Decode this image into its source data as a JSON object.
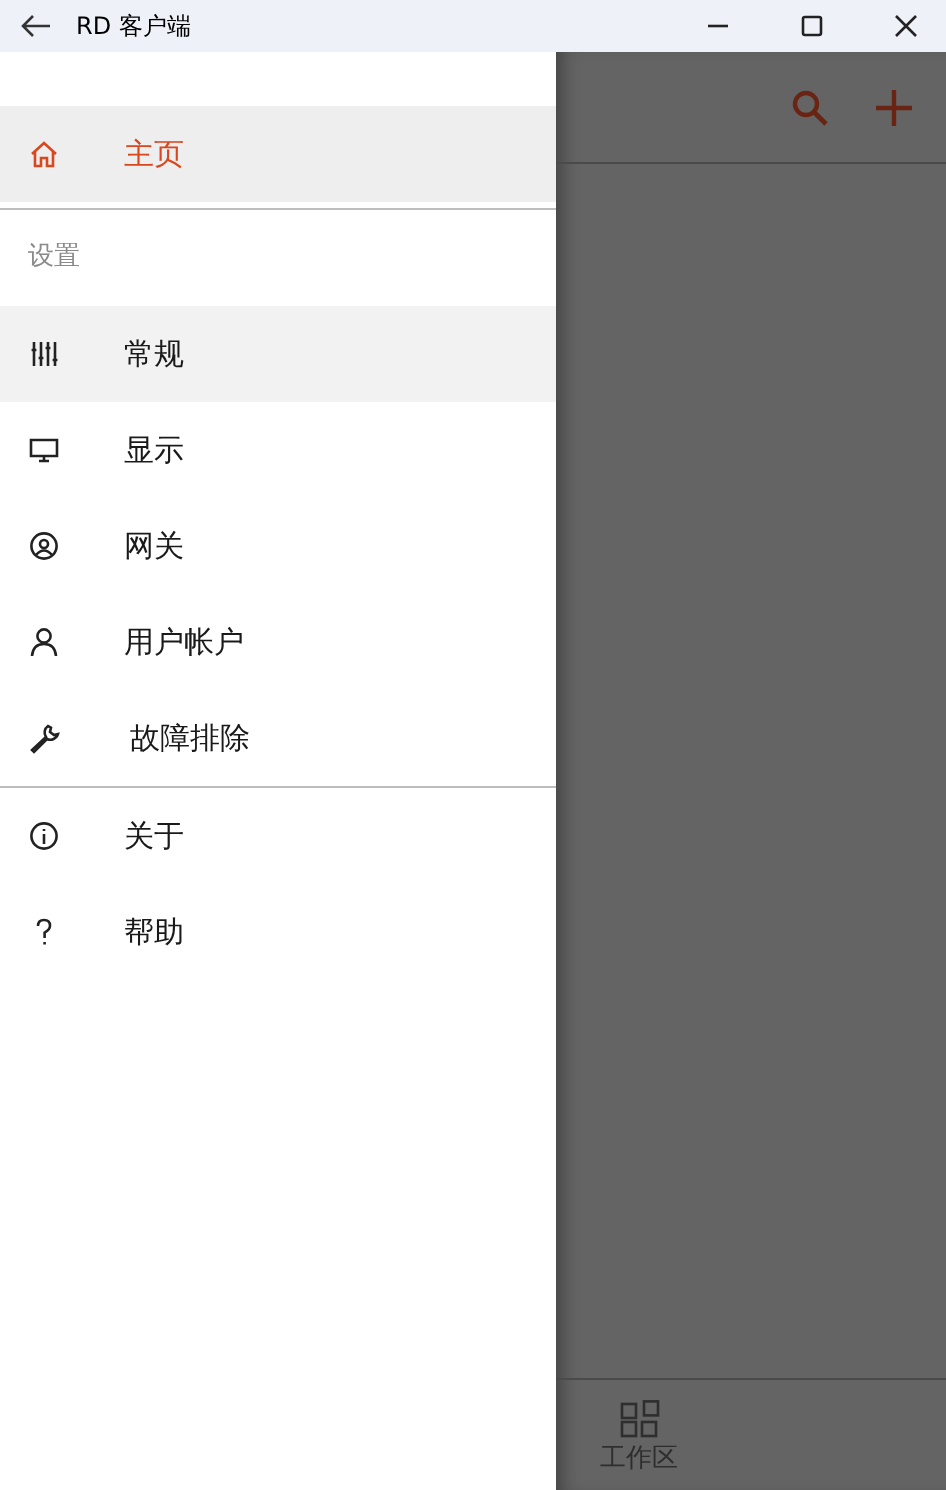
{
  "window": {
    "title": "RD 客户端"
  },
  "drawer": {
    "top_items": [
      {
        "label": "主页",
        "selected": true
      }
    ],
    "settings_header": "设置",
    "settings_items": [
      {
        "label": "常规",
        "selected": false,
        "hovered": true
      },
      {
        "label": "显示",
        "selected": false,
        "hovered": false
      },
      {
        "label": "网关",
        "selected": false,
        "hovered": false
      },
      {
        "label": "用户帐户",
        "selected": false,
        "hovered": false
      },
      {
        "label": "故障排除",
        "selected": false,
        "hovered": false
      }
    ],
    "bottom_items": [
      {
        "label": "关于",
        "selected": false
      },
      {
        "label": "帮助",
        "selected": false
      }
    ]
  },
  "bottom_tabs": [
    {
      "label": "工作区"
    }
  ]
}
